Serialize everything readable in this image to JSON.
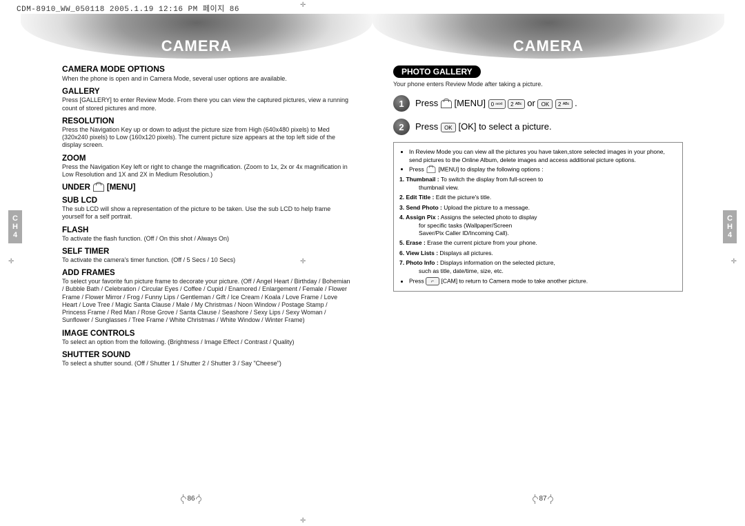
{
  "meta": {
    "header_line": "CDM-8910_WW_050118  2005.1.19  12:16 PM  페이지 86"
  },
  "ch_tab": {
    "line1": "C",
    "line2": "H",
    "line3": "4"
  },
  "left": {
    "banner": "CAMERA",
    "title": "CAMERA MODE OPTIONS",
    "intro": "When the phone is open and in Camera Mode, several user options are available.",
    "gallery": {
      "h": "GALLERY",
      "p": "Press       [GALLERY] to enter Review Mode. From there you can view the captured pictures, view a running count of stored pictures and more."
    },
    "resolution": {
      "h": "RESOLUTION",
      "p": "Press the Navigation Key up or down to adjust the picture size from High (640x480 pixels) to Med (320x240 pixels) to Low (160x120 pixels). The current picture size appears at the top left side of the display screen."
    },
    "zoom": {
      "h": "ZOOM",
      "p": "Press the Navigation Key left or right to change the magnification. (Zoom to 1x, 2x or 4x magnification in Low Resolution and 1X and 2X in Medium Resolution.)"
    },
    "under": {
      "pre": "UNDER",
      "post": "[MENU]"
    },
    "sublcd": {
      "h": "SUB LCD",
      "p": "The sub LCD will show a representation of the picture to be taken. Use the sub LCD to help frame yourself for a self portrait."
    },
    "flash": {
      "h": "FLASH",
      "p": "To activate the flash function. (Off / On this shot / Always On)"
    },
    "selftimer": {
      "h": "SELF TIMER",
      "p": "To activate the camera's timer function. (Off / 5 Secs / 10 Secs)"
    },
    "addframes": {
      "h": "ADD FRAMES",
      "p": "To select your favorite fun picture frame to decorate your picture. (Off / Angel Heart / Birthday / Bohemian / Bubble Bath / Celebration / Circular Eyes / Coffee / Cupid / Enamored / Enlargement / Female / Flower Frame / Flower Mirror / Frog / Funny Lips / Gentleman / Gift / Ice Cream / Koala / Love Frame / Love Heart / Love Tree / Magic Santa Clause / Male / My Christmas / Noon Window / Postage Stamp / Princess Frame / Red Man / Rose Grove / Santa Clause / Seashore / Sexy Lips / Sexy Woman / Sunflower / Sunglasses / Tree Frame / White Christmas / White Window / Winter Frame)"
    },
    "imagecontrols": {
      "h": "IMAGE CONTROLS",
      "p": "To select an option from the following. (Brightness / Image Effect / Contrast / Quality)"
    },
    "shuttersound": {
      "h": "SHUTTER SOUND",
      "p": "To select a shutter sound. (Off / Shutter 1 / Shutter 2 / Shutter 3 / Say \"Cheese\")"
    },
    "page_num": "86"
  },
  "right": {
    "banner": "CAMERA",
    "gallery_title": "PHOTO GALLERY",
    "intro": "Your phone enters Review Mode after taking a picture.",
    "step1": {
      "pre": "Press ",
      "menu": " [MENU] ",
      "or": " or ",
      "dot": " ."
    },
    "step2": "Press        [OK] to select a picture.",
    "box": {
      "b1": "In Review Mode you can view all the pictures you have taken,store selected images in your phone, send pictures to the Online Album, delete images and access additional picture options.",
      "b2_pre": "Press ",
      "b2_post": " [MENU] to display the following options :",
      "e1": {
        "n": "1. Thumbnail :",
        "t": " To switch the display from full-screen to",
        "t2": "thumbnail view."
      },
      "e2": {
        "n": "2. Edit Title :",
        "t": " Edit the picture's title."
      },
      "e3": {
        "n": "3. Send Photo :",
        "t": " Upload the picture to a message."
      },
      "e4": {
        "n": "4. Assign Pix :",
        "t": " Assigns the selected photo to display",
        "t2": "for specific tasks (Wallpaper/Screen",
        "t3": "Saver/Pix Caller ID/Incoming Call)."
      },
      "e5": {
        "n": "5. Erase :",
        "t": " Erase the current picture from your phone."
      },
      "e6": {
        "n": "6. View Lists :",
        "t": " Displays all pictures."
      },
      "e7": {
        "n": "7. Photo Info :",
        "t": " Displays information on the selected picture,",
        "t2": "such as title, date/time, size, etc."
      },
      "b3_pre": "Press ",
      "b3_post": " [CAM] to return to Camera mode to take another picture."
    },
    "page_num": "87"
  }
}
